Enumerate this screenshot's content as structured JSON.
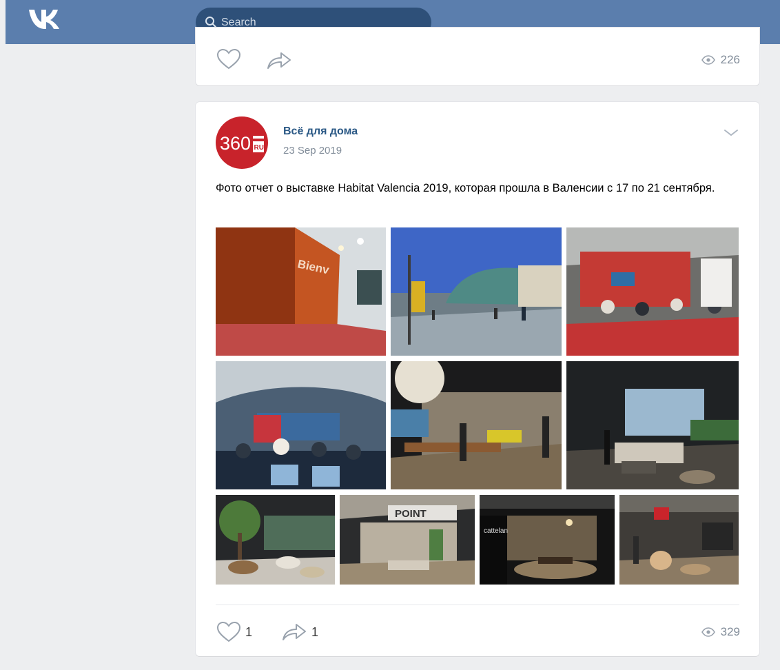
{
  "header": {
    "logo_icon": "vk-logo-icon",
    "search": {
      "placeholder": "Search",
      "icon": "search-icon"
    }
  },
  "previous_post": {
    "like_icon": "heart-icon",
    "share_icon": "share-arrow-icon",
    "views_icon": "eye-icon",
    "views": "226"
  },
  "post": {
    "author": "Всё для дома",
    "date": "23 Sep 2019",
    "avatar_text": "360",
    "avatar_sub": "RU",
    "menu_icon": "chevron-down-icon",
    "text": "Фото отчет о выставке Habitat Valencia 2019, которая прошла в Валенсии с 17 по 21 сентября.",
    "photos_count": 10,
    "likes": "1",
    "shares": "1",
    "views": "329"
  },
  "colors": {
    "header_bg": "#5b7ead",
    "search_bg": "#2e5079",
    "link": "#2a5885",
    "avatar_bg": "#c8232b",
    "page_bg": "#edeef0"
  }
}
